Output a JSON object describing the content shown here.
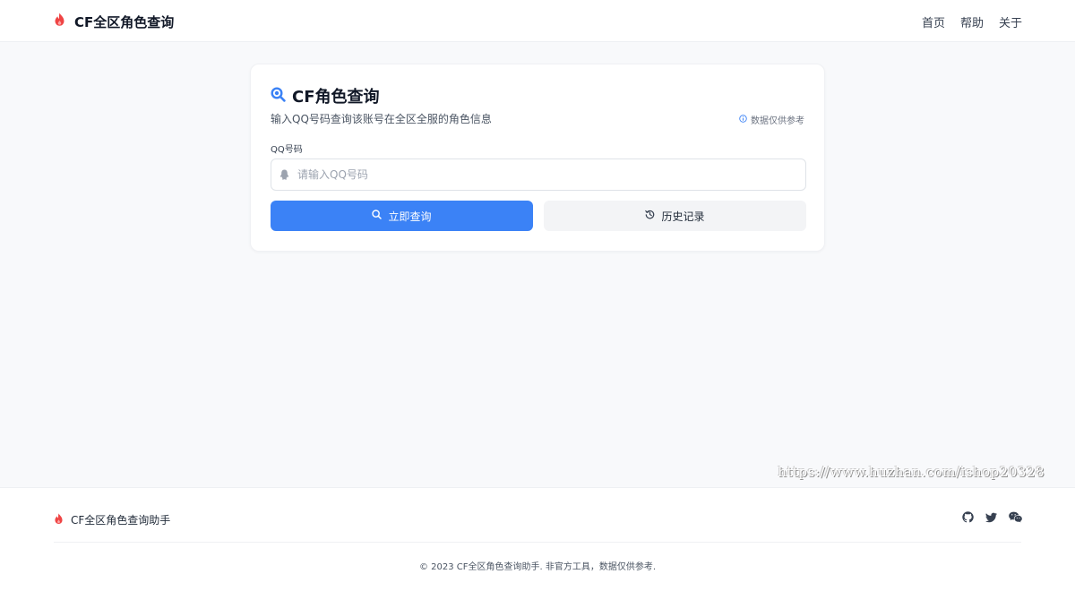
{
  "header": {
    "brand_title": "CF全区角色查询",
    "nav": {
      "home": "首页",
      "help": "帮助",
      "about": "关于"
    }
  },
  "card": {
    "title": "CF角色查询",
    "subtitle": "输入QQ号码查询该账号在全区全服的角色信息",
    "note": "数据仅供参考",
    "field_label": "QQ号码",
    "input_placeholder": "请输入QQ号码",
    "input_value": "",
    "search_button": "立即查询",
    "history_button": "历史记录"
  },
  "watermark": "https://www.huzhan.com/ishop20328",
  "footer": {
    "brand_name": "CF全区角色查询助手",
    "copyright": "© 2023 CF全区角色查询助手. 非官方工具，数据仅供参考."
  },
  "icons": {
    "brand": "fire-icon",
    "title": "search-magnify-icon",
    "note": "info-circle-icon",
    "input": "qq-penguin-icon",
    "search_button": "search-icon",
    "history_button": "history-icon",
    "social": [
      "github-icon",
      "twitter-icon",
      "wechat-icon"
    ]
  },
  "colors": {
    "accent": "#3b82f6",
    "brand_flame": "#ef4444",
    "background": "#f8f9fb",
    "secondary_button": "#f3f4f6"
  }
}
